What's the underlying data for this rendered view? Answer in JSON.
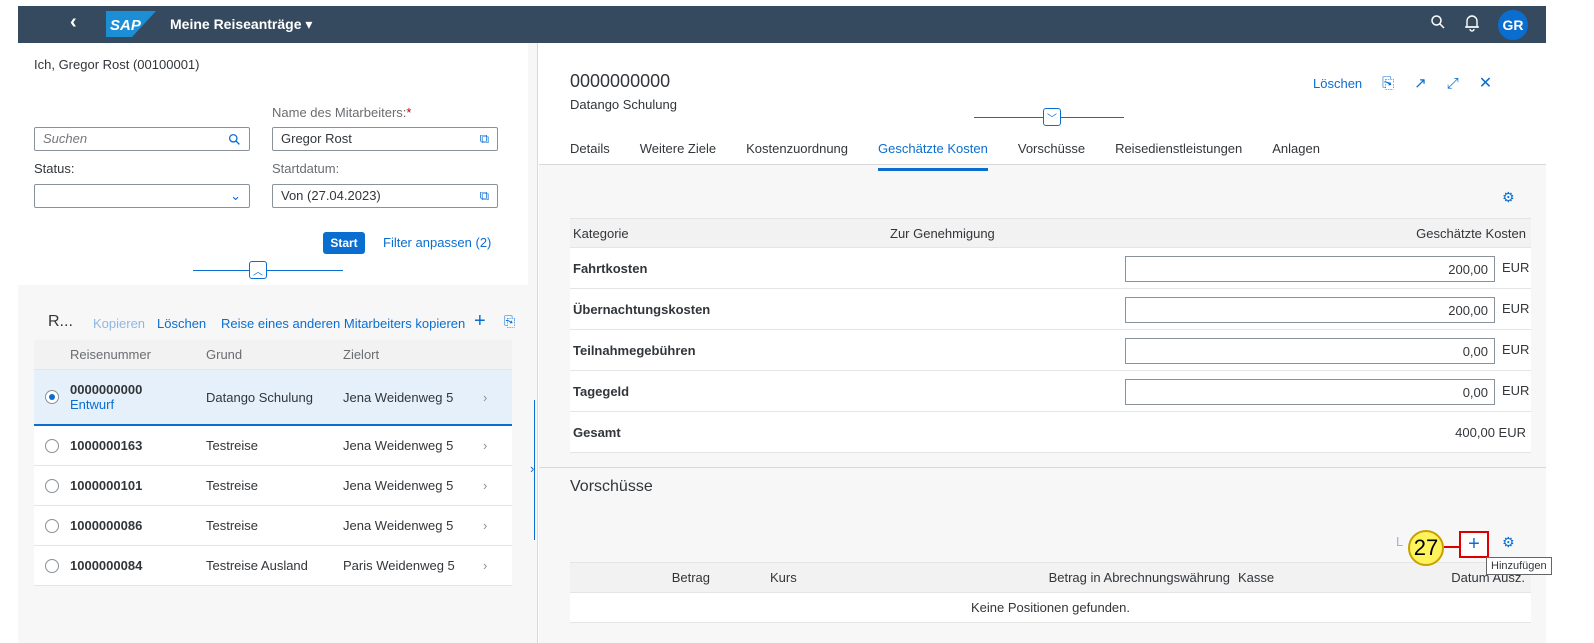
{
  "shell": {
    "title": "Meine Reiseanträge ▾",
    "avatar": "GR",
    "logo": "SAP"
  },
  "left": {
    "user": "Ich, Gregor Rost (00100001)",
    "name_label": "Name des Mitarbeiters:",
    "required_mark": "*",
    "search_placeholder": "Suchen",
    "name_value": "Gregor Rost",
    "status_label": "Status:",
    "start_label": "Startdatum:",
    "start_value": "Von (27.04.2023)",
    "start_btn": "Start",
    "filter_link": "Filter anpassen (2)",
    "list_title": "R...",
    "copy": "Kopieren",
    "delete": "Löschen",
    "copy_other": "Reise eines anderen Mitarbeiters kopieren",
    "columns": [
      "Reisenummer",
      "Grund",
      "Zielort"
    ],
    "rows": [
      {
        "nr": "0000000000",
        "status": "Entwurf",
        "grund": "Datango Schulung",
        "ziel": "Jena Weidenweg 5"
      },
      {
        "nr": "1000000163",
        "grund": "Testreise",
        "ziel": "Jena Weidenweg 5"
      },
      {
        "nr": "1000000101",
        "grund": "Testreise",
        "ziel": "Jena Weidenweg 5"
      },
      {
        "nr": "1000000086",
        "grund": "Testreise",
        "ziel": "Jena Weidenweg 5"
      },
      {
        "nr": "1000000084",
        "grund": "Testreise Ausland",
        "ziel": "Paris Weidenweg 5"
      }
    ]
  },
  "right": {
    "title": "0000000000",
    "subtitle": "Datango Schulung",
    "delete": "Löschen",
    "tabs": [
      "Details",
      "Weitere Ziele",
      "Kostenzuordnung",
      "Geschätzte Kosten",
      "Vorschüsse",
      "Reisedienstleistungen",
      "Anlagen"
    ],
    "cost_headers": [
      "Kategorie",
      "Zur Genehmigung",
      "Geschätzte Kosten"
    ],
    "costs": [
      {
        "cat": "Fahrtkosten",
        "amount": "200,00",
        "cur": "EUR"
      },
      {
        "cat": "Übernachtungskosten",
        "amount": "200,00",
        "cur": "EUR"
      },
      {
        "cat": "Teilnahmegebühren",
        "amount": "0,00",
        "cur": "EUR"
      },
      {
        "cat": "Tagegeld",
        "amount": "0,00",
        "cur": "EUR"
      }
    ],
    "total_label": "Gesamt",
    "total_value": "400,00 EUR",
    "advances_title": "Vorschüsse",
    "adv_headers": [
      "Betrag",
      "Kurs",
      "Betrag in Abrechnungswährung",
      "Kasse",
      "Datum Ausz."
    ],
    "empty": "Keine Positionen gefunden.",
    "callout": "27",
    "tooltip": "Hinzufügen",
    "clipped_delete": "L"
  }
}
